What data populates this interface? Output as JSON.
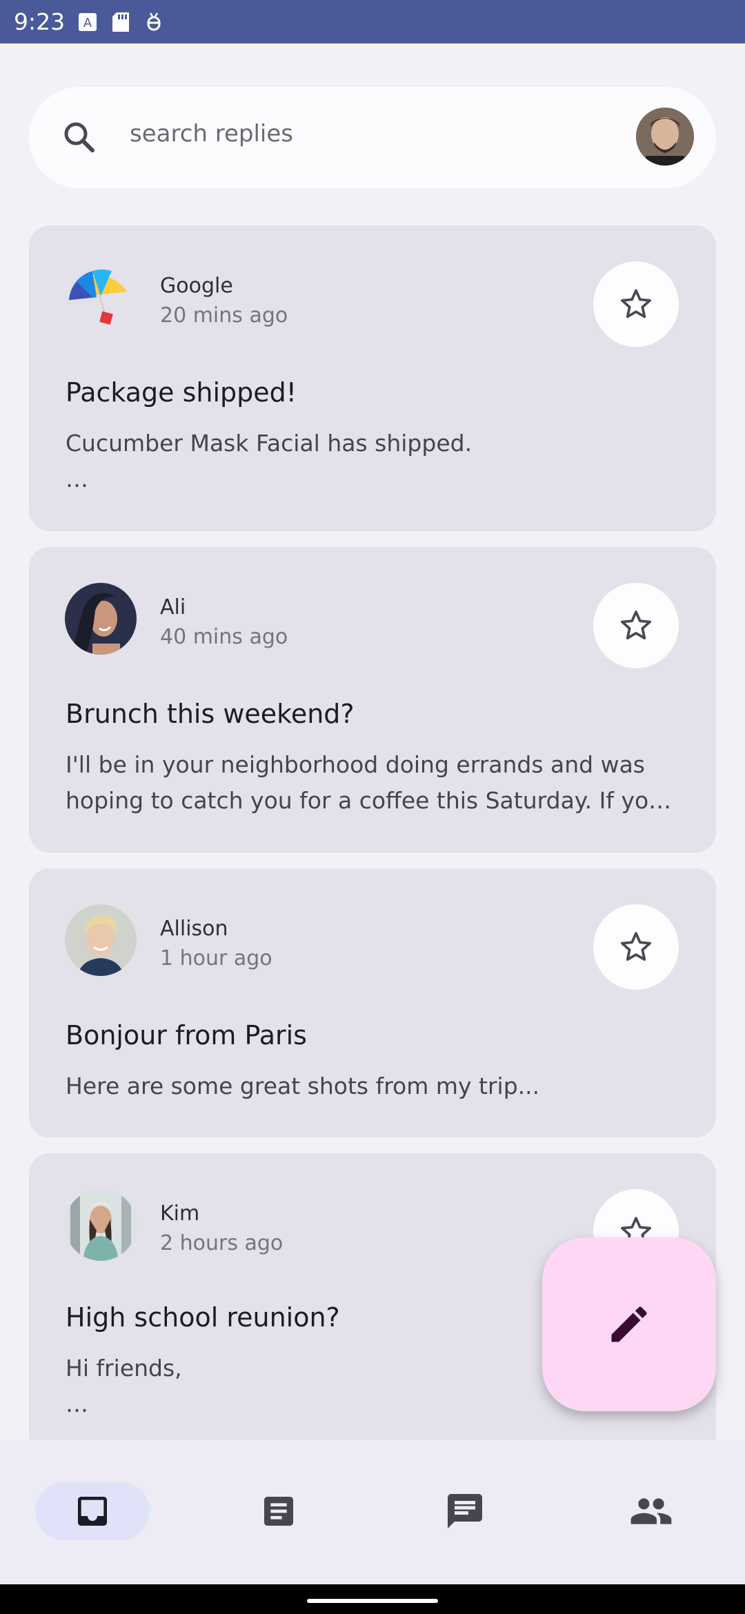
{
  "status_bar": {
    "time": "9:23"
  },
  "search": {
    "placeholder": "search replies"
  },
  "emails": [
    {
      "sender": "Google",
      "time": "20 mins ago",
      "subject": "Package shipped!",
      "body": "Cucumber Mask Facial has shipped.\n…"
    },
    {
      "sender": "Ali",
      "time": "40 mins ago",
      "subject": "Brunch this weekend?",
      "body": "I'll be in your neighborhood doing errands and was hoping to catch you for a coffee this Saturday. If yo…"
    },
    {
      "sender": "Allison",
      "time": "1 hour ago",
      "subject": "Bonjour from Paris",
      "body": "Here are some great shots from my trip..."
    },
    {
      "sender": "Kim",
      "time": "2 hours ago",
      "subject": "High school reunion?",
      "body": "Hi friends,\n…"
    }
  ],
  "nav": {
    "items": [
      {
        "icon": "inbox-icon",
        "active": true
      },
      {
        "icon": "article-icon",
        "active": false
      },
      {
        "icon": "chat-icon",
        "active": false
      },
      {
        "icon": "people-icon",
        "active": false
      }
    ]
  },
  "colors": {
    "status_bar": "#4a5999",
    "card": "#e3e1ea",
    "fab": "#fdd7f3",
    "nav_active": "#dfe2f8"
  }
}
